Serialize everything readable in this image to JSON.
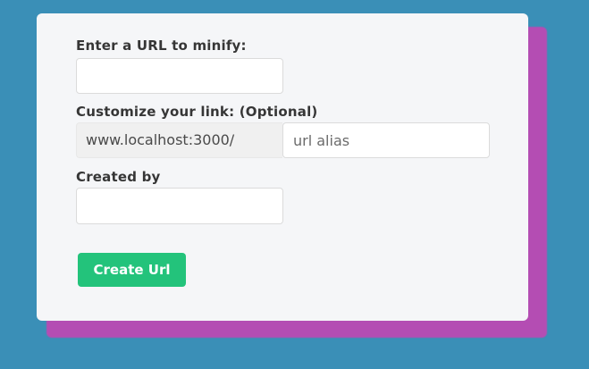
{
  "form": {
    "url_label": "Enter a URL to minify:",
    "url_value": "",
    "customize_label": "Customize your link: (Optional)",
    "base_url": "www.localhost:3000/",
    "alias_placeholder": "url alias",
    "alias_value": "",
    "created_by_label": "Created by",
    "created_by_value": "",
    "submit_label": "Create Url"
  },
  "colors": {
    "background": "#3a8fb7",
    "card": "#f5f6f8",
    "card_shadow": "#b44db3",
    "button": "#23c37b"
  }
}
